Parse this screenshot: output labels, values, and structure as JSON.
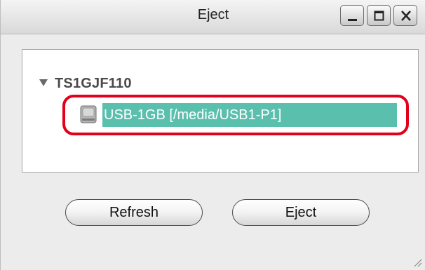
{
  "window": {
    "title": "Eject",
    "controls": {
      "minimize_icon": "minimize-icon",
      "maximize_icon": "maximize-icon",
      "close_icon": "close-icon"
    }
  },
  "tree": {
    "parent": {
      "label": "TS1GJF110",
      "expanded": true
    },
    "child": {
      "label": "USB-1GB [/media/USB1-P1]",
      "icon": "drive-icon",
      "selected": true,
      "highlighted": true
    }
  },
  "buttons": {
    "refresh_label": "Refresh",
    "eject_label": "Eject"
  },
  "colors": {
    "selection": "#5bbfae",
    "highlight_ring": "#e2001a"
  }
}
